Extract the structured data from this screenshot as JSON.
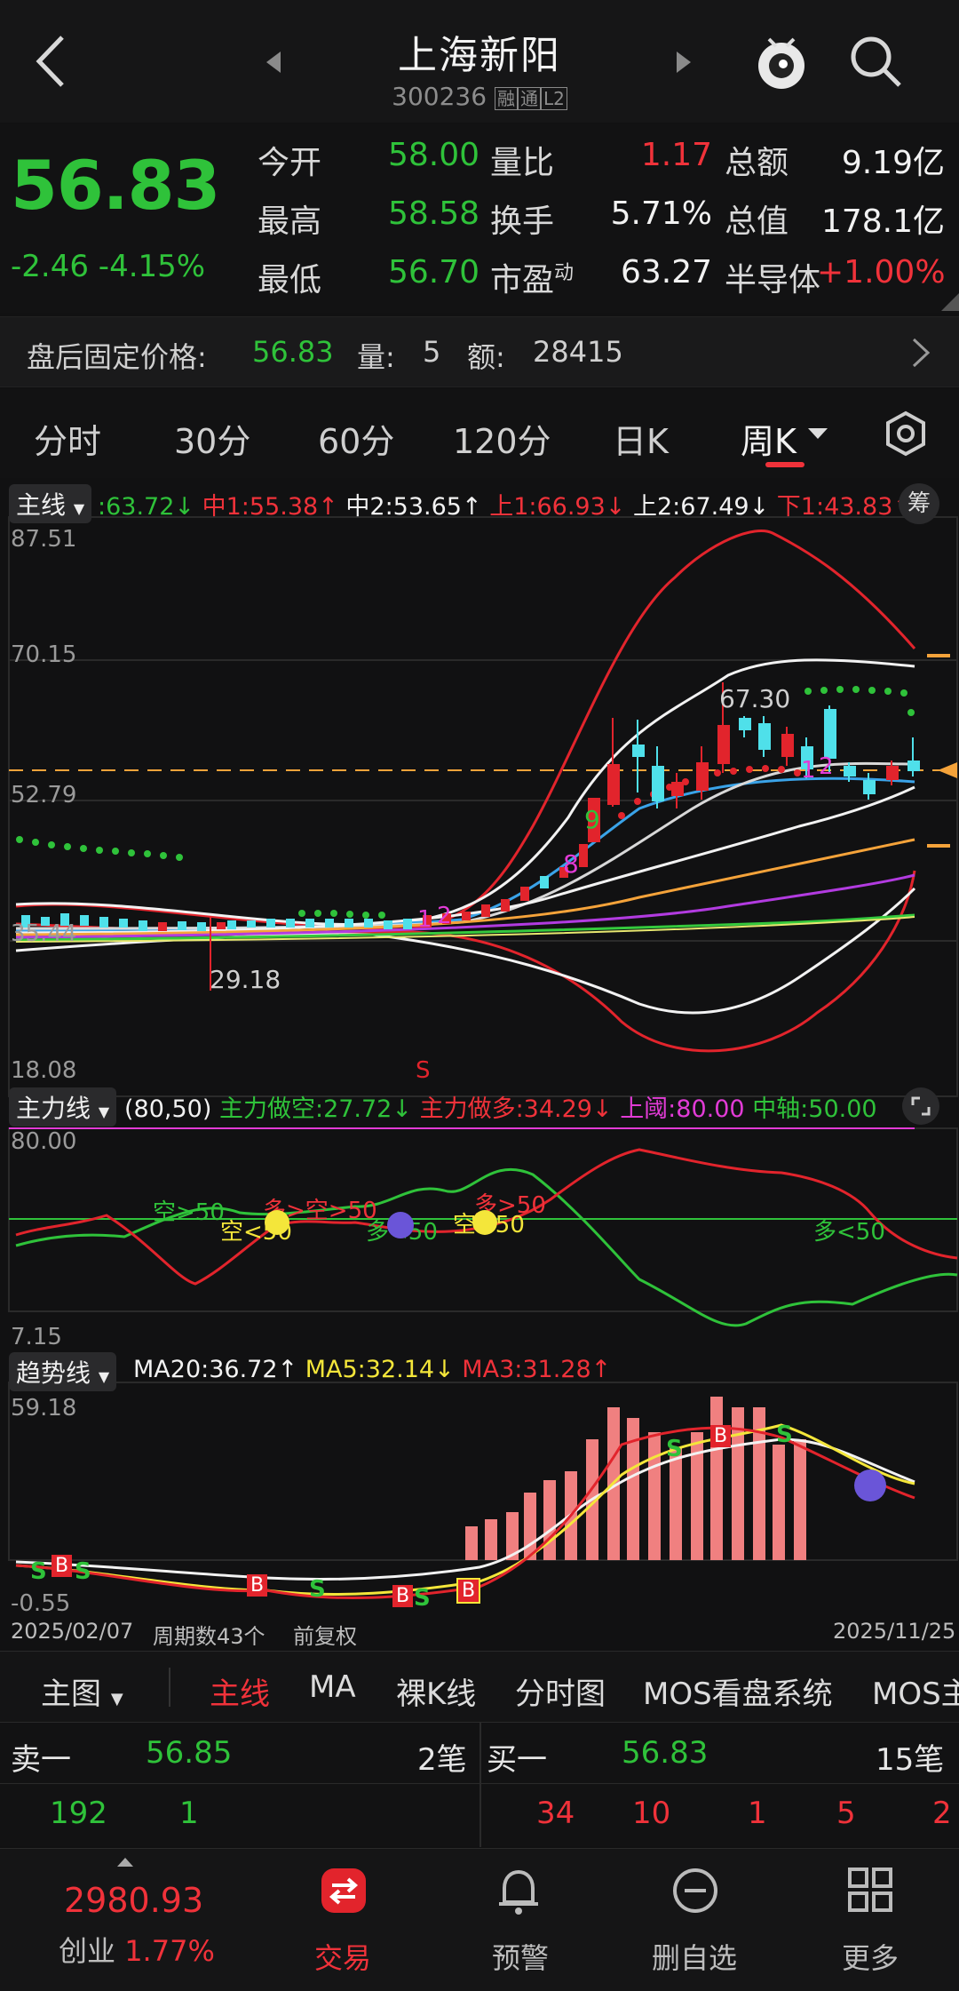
{
  "header": {
    "title": "上海新阳",
    "code": "300236",
    "badges": [
      "融",
      "通",
      "L2"
    ]
  },
  "quote": {
    "price": "56.83",
    "change": "-2.46",
    "change_pct": "-4.15%",
    "rows": [
      {
        "l1": "今开",
        "v1": "58.00",
        "l2": "量比",
        "v2": "1.17",
        "l3": "总额",
        "v3": "9.19亿"
      },
      {
        "l1": "最高",
        "v1": "58.58",
        "l2": "换手",
        "v2": "5.71%",
        "l3": "总值",
        "v3": "178.1亿"
      },
      {
        "l1": "最低",
        "v1": "56.70",
        "l2": "市盈",
        "l2sup": "动",
        "v2": "63.27",
        "l3": "半导体",
        "v3": "+1.00%"
      }
    ]
  },
  "after_hours": {
    "label": "盘后固定价格:",
    "price": "56.83",
    "vol_label": "量:",
    "vol": "5",
    "amt_label": "额:",
    "amt": "28415"
  },
  "tabs": [
    "分时",
    "30分",
    "60分",
    "120分",
    "日K",
    "周K"
  ],
  "main_chart": {
    "selector": "主线",
    "legend": [
      {
        "text": ":63.72↓",
        "color": "#2fc23a"
      },
      {
        "text": "中1:55.38↑",
        "color": "#f0323a"
      },
      {
        "text": "中2:53.65↑",
        "color": "#f2f2f2"
      },
      {
        "text": "上1:66.93↓",
        "color": "#f0323a"
      },
      {
        "text": "上2:67.49↓",
        "color": "#f2f2f2"
      },
      {
        "text": "下1:43.83↑",
        "color": "#f0323a"
      }
    ],
    "chip_button": "筹",
    "y_labels": [
      "87.51",
      "70.15",
      "52.79",
      "35.44",
      "18.08"
    ],
    "annotations": {
      "high": "67.30",
      "low": "29.18",
      "n9": "9",
      "n8": "8",
      "n1": "1",
      "n2": "2",
      "s": "S",
      "n1b": "1",
      "n2b": "2"
    }
  },
  "force_chart": {
    "selector": "主力线",
    "legend": [
      {
        "text": "(80,50)",
        "color": "#f2f2f2"
      },
      {
        "text": "主力做空:27.72↓",
        "color": "#2fc23a"
      },
      {
        "text": "主力做多:34.29↓",
        "color": "#f0323a"
      },
      {
        "text": "上阈:80.00",
        "color": "#e23bd6"
      },
      {
        "text": "中轴:50.00",
        "color": "#2fc23a"
      }
    ],
    "y_labels": [
      "80.00",
      "7.15"
    ],
    "annotations": [
      "空>50",
      "多>空>50",
      "空<50",
      "多<50",
      "空<50",
      "多>50",
      "多<50"
    ]
  },
  "trend_chart": {
    "selector": "趋势线",
    "legend": [
      {
        "text": "MA20:36.72↑",
        "color": "#f2f2f2"
      },
      {
        "text": "MA5:32.14↓",
        "color": "#f4e63a"
      },
      {
        "text": "MA3:31.28↑",
        "color": "#f0323a"
      }
    ],
    "y_labels": [
      "59.18",
      "-0.55"
    ],
    "markers": {
      "b": "B",
      "s": "S"
    }
  },
  "date_bar": {
    "start": "2025/02/07",
    "periods": "周期数43个",
    "adjust": "前复权",
    "end": "2025/11/25"
  },
  "toolbar": {
    "main": "主图",
    "items": [
      "主线",
      "MA",
      "裸K线",
      "分时图",
      "MOS看盘系统",
      "MOS主"
    ]
  },
  "orderbook": {
    "sell_label": "卖一",
    "sell_price": "56.85",
    "sell_count": "2笔",
    "buy_label": "买一",
    "buy_price": "56.83",
    "buy_count": "15笔",
    "sell_qty": [
      "192",
      "1"
    ],
    "buy_qty": [
      "34",
      "10",
      "1",
      "5",
      "2"
    ]
  },
  "navbar": {
    "index_value": "2980.93",
    "index_name": "创业",
    "index_pct": "1.77%",
    "items": [
      "交易",
      "预警",
      "删自选",
      "更多"
    ]
  },
  "colors": {
    "up": "#f0323a",
    "down": "#2fc23a",
    "accent": "#f5a33a",
    "bg": "#111112"
  }
}
